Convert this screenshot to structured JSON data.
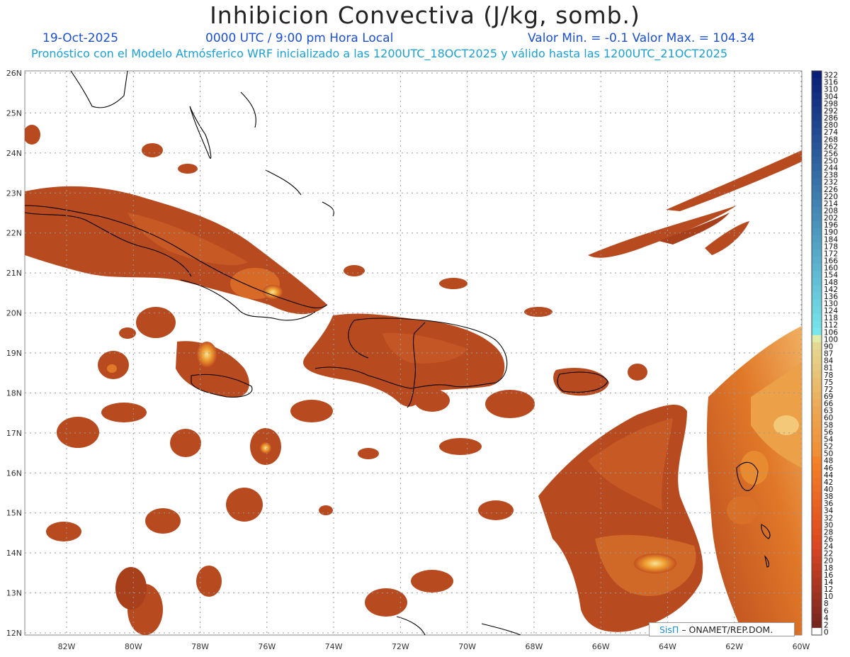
{
  "header": {
    "title": "Inhibicion Convectiva (J/kg, somb.)",
    "date": "19-Oct-2025",
    "time": "0000 UTC / 9:00 pm Hora Local",
    "valrange": "Valor Min. = -0.1  Valor Max. = 104.34",
    "forecast": "Pronóstico con el Modelo Atmósferico WRF inicializado a las 1200UTC_18OCT2025 y válido hasta las  1200UTC_21OCT2025"
  },
  "axes": {
    "lat_labels": [
      "26N",
      "25N",
      "24N",
      "23N",
      "22N",
      "21N",
      "20N",
      "19N",
      "18N",
      "17N",
      "16N",
      "15N",
      "14N",
      "13N",
      "12N"
    ],
    "lon_labels": [
      "82W",
      "80W",
      "78W",
      "76W",
      "74W",
      "72W",
      "70W",
      "68W",
      "66W",
      "64W",
      "62W",
      "60W"
    ]
  },
  "colorbar": {
    "labels": [
      "322",
      "316",
      "310",
      "304",
      "298",
      "292",
      "286",
      "280",
      "274",
      "268",
      "262",
      "256",
      "250",
      "244",
      "238",
      "232",
      "226",
      "220",
      "214",
      "208",
      "202",
      "196",
      "190",
      "184",
      "178",
      "172",
      "166",
      "160",
      "154",
      "148",
      "142",
      "136",
      "130",
      "124",
      "118",
      "112",
      "106",
      "100",
      "90",
      "87",
      "84",
      "81",
      "78",
      "75",
      "72",
      "69",
      "66",
      "63",
      "60",
      "58",
      "56",
      "54",
      "52",
      "50",
      "48",
      "46",
      "44",
      "42",
      "40",
      "38",
      "36",
      "34",
      "32",
      "30",
      "28",
      "26",
      "24",
      "22",
      "20",
      "18",
      "16",
      "14",
      "12",
      "10",
      "8",
      "6",
      "4",
      "2",
      "0"
    ]
  },
  "credit": {
    "brand": "SisΠ",
    "text": "– ONAMET/REP.DOM."
  },
  "colors": {
    "field_dark": "#7a2c18",
    "field_mid": "#b84a20",
    "field_bright": "#e8962a",
    "subtitle_blue": "#1a4fd6",
    "subtitle_cyan": "#1aa0d6"
  }
}
